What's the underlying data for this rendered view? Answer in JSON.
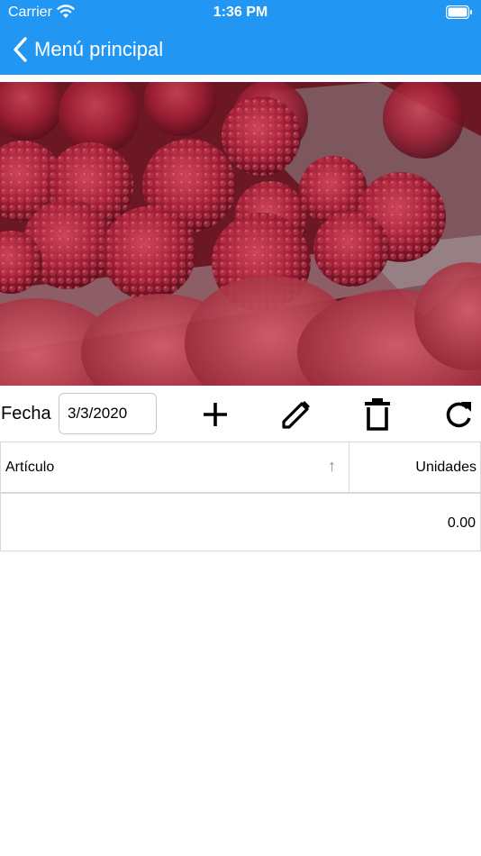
{
  "status_bar": {
    "carrier": "Carrier",
    "time": "1:36 PM"
  },
  "nav": {
    "back_label": "Menú principal"
  },
  "toolbar": {
    "fecha_label": "Fecha",
    "date_value": "3/3/2020",
    "buttons": [
      "add-icon",
      "edit-icon",
      "delete-icon",
      "refresh-icon"
    ]
  },
  "table": {
    "columns": [
      "Artículo",
      "Unidades"
    ],
    "sort_indicator": "↑",
    "rows": [
      {
        "articulo": "",
        "unidades": "0.00"
      }
    ]
  },
  "colors": {
    "primary": "#2196f3",
    "border": "#d9d9d9"
  }
}
